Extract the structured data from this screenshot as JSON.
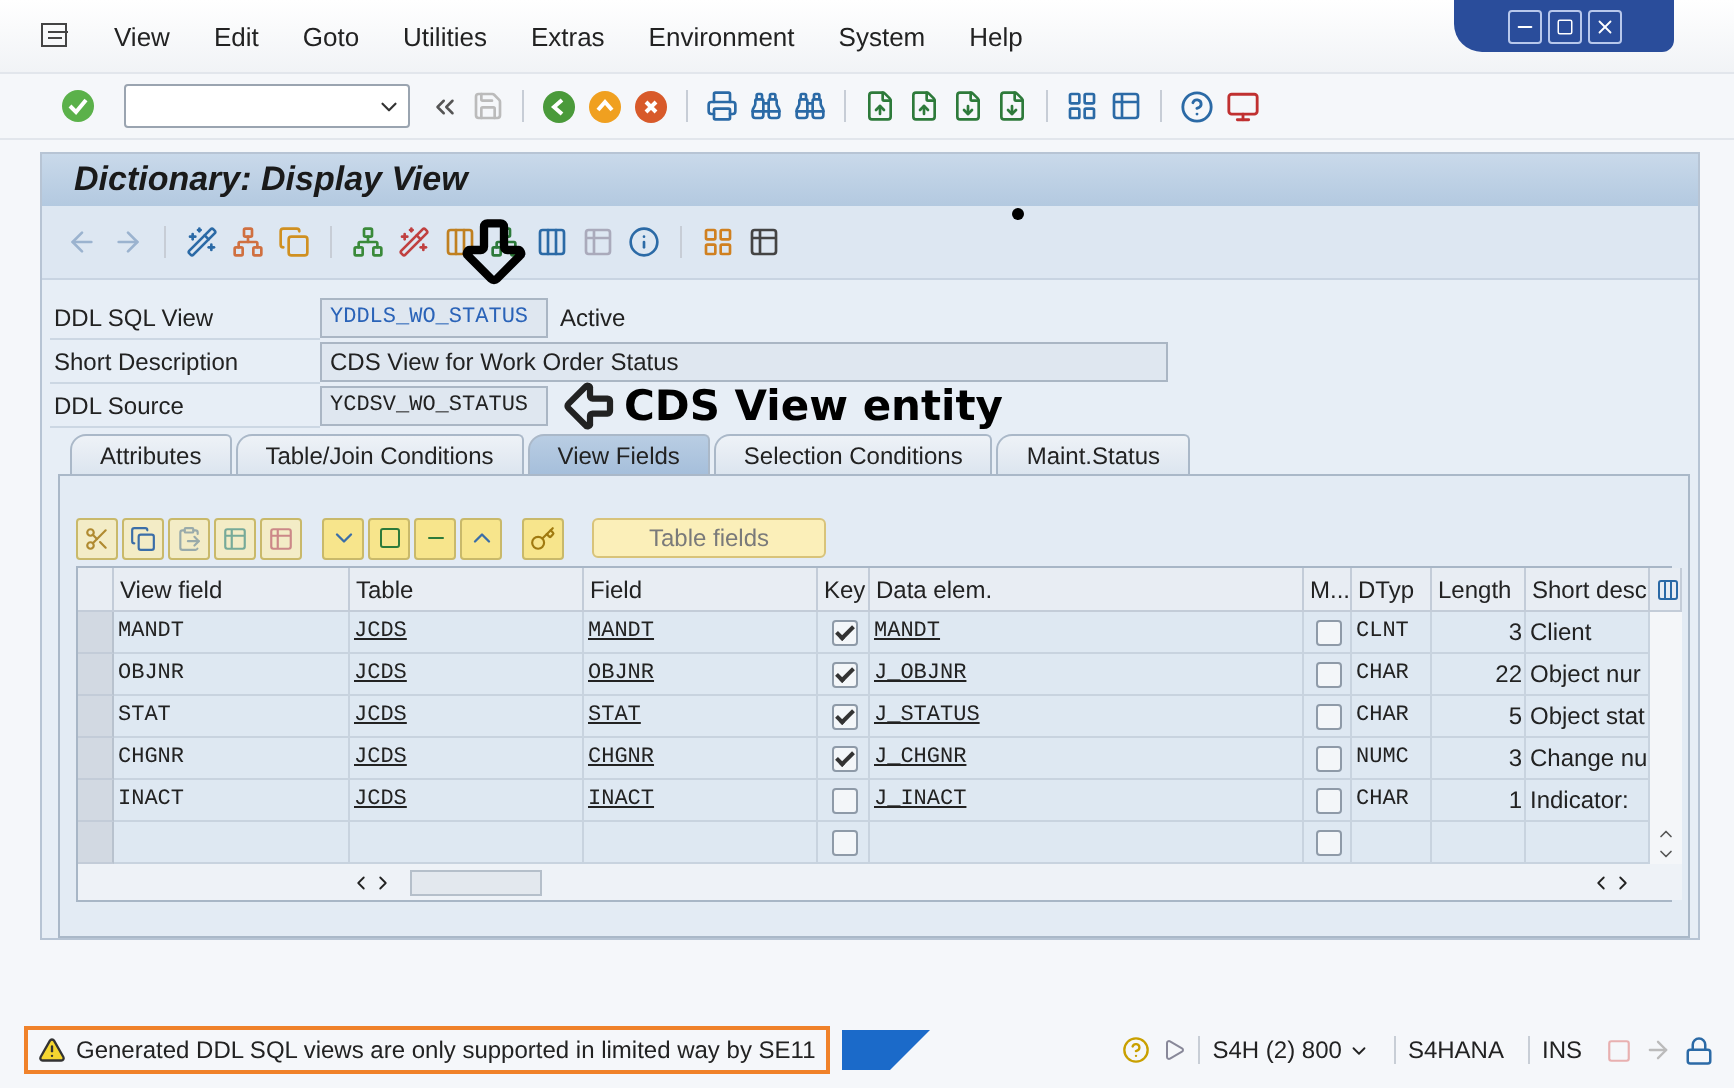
{
  "menu": [
    "View",
    "Edit",
    "Goto",
    "Utilities",
    "Extras",
    "Environment",
    "System",
    "Help"
  ],
  "title": "Dictionary: Display View",
  "form": [
    {
      "label": "DDL SQL View",
      "value": "YDDLS_WO_STATUS",
      "status": "Active",
      "kind": "link"
    },
    {
      "label": "Short Description",
      "value": "CDS View for Work Order Status",
      "kind": "text"
    },
    {
      "label": "DDL Source",
      "value": "YCDSV_WO_STATUS",
      "kind": "annotated",
      "annotation": "CDS View entity"
    }
  ],
  "tabs": [
    {
      "label": "Attributes",
      "selected": false
    },
    {
      "label": "Table/Join Conditions",
      "selected": false
    },
    {
      "label": "View Fields",
      "selected": true
    },
    {
      "label": "Selection Conditions",
      "selected": false
    },
    {
      "label": "Maint.Status",
      "selected": false
    }
  ],
  "table_button": "Table fields",
  "table": {
    "columns": [
      "View field",
      "Table",
      "Field",
      "Key",
      "Data elem.",
      "M...",
      "DTyp",
      "Length",
      "Short desc"
    ],
    "rows": [
      {
        "view_field": "MANDT",
        "table": "JCDS",
        "field": "MANDT",
        "key": true,
        "data_element": "MANDT",
        "m": false,
        "dtyp": "CLNT",
        "length": "3",
        "short_desc": "Client"
      },
      {
        "view_field": "OBJNR",
        "table": "JCDS",
        "field": "OBJNR",
        "key": true,
        "data_element": "J_OBJNR",
        "m": false,
        "dtyp": "CHAR",
        "length": "22",
        "short_desc": "Object nur"
      },
      {
        "view_field": "STAT",
        "table": "JCDS",
        "field": "STAT",
        "key": true,
        "data_element": "J_STATUS",
        "m": false,
        "dtyp": "CHAR",
        "length": "5",
        "short_desc": "Object stat"
      },
      {
        "view_field": "CHGNR",
        "table": "JCDS",
        "field": "CHGNR",
        "key": true,
        "data_element": "J_CHGNR",
        "m": false,
        "dtyp": "NUMC",
        "length": "3",
        "short_desc": "Change nu"
      },
      {
        "view_field": "INACT",
        "table": "JCDS",
        "field": "INACT",
        "key": false,
        "data_element": "J_INACT",
        "m": false,
        "dtyp": "CHAR",
        "length": "1",
        "short_desc": "Indicator:"
      }
    ],
    "empty_rows": [
      {
        "key": false,
        "m": false
      }
    ]
  },
  "status_bar": {
    "message": "Generated DDL SQL views are only supported in limited way by SE11",
    "highlighted": true,
    "system": "S4H (2) 800",
    "server": "S4HANA",
    "mode": "INS"
  }
}
